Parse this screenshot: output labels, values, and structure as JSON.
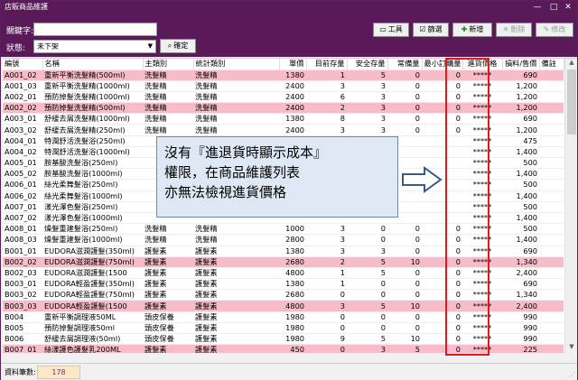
{
  "window": {
    "title": "店販商品維護",
    "min": "—",
    "max": "□",
    "close": "✕"
  },
  "filters": {
    "keyword_label": "關鍵字:",
    "keyword_value": "",
    "status_label": "狀態:",
    "status_value": "未下架",
    "confirm_label": "確定"
  },
  "toolbar": {
    "tools_label": "工具",
    "filter_label": "篩選",
    "add_label": "新增",
    "delete_label": "刪除",
    "edit_label": "修改"
  },
  "columns": [
    "編號",
    "名稱",
    "主類別",
    "統計類別",
    "單價",
    "目前存量",
    "安全存量",
    "常備量",
    "最小訂購量",
    "進貨價格",
    "損料/售價",
    "備註"
  ],
  "rows": [
    {
      "id": "A001_02",
      "name": "重新平衡洗髮精(500ml)",
      "cat": "洗髮精",
      "stat": "洗髮精",
      "price": "1380",
      "stock": "1",
      "safe": "5",
      "regular": "0",
      "min": "0",
      "cost": "*****",
      "ratio": "690",
      "note": "",
      "pink": true
    },
    {
      "id": "A001_03",
      "name": "重新平衡洗髮精(1000ml)",
      "cat": "洗髮精",
      "stat": "洗髮精",
      "price": "2400",
      "stock": "3",
      "safe": "3",
      "regular": "0",
      "min": "0",
      "cost": "*****",
      "ratio": "1,200",
      "note": "",
      "pink": false
    },
    {
      "id": "A002_01",
      "name": "預防掉髮洗髮精(1000ml)",
      "cat": "洗髮精",
      "stat": "洗髮精",
      "price": "2400",
      "stock": "6",
      "safe": "3",
      "regular": "0",
      "min": "0",
      "cost": "*****",
      "ratio": "1,200",
      "note": "",
      "pink": false
    },
    {
      "id": "A002_02",
      "name": "預防掉髮洗髮精(500ml)",
      "cat": "洗髮精",
      "stat": "洗髮精",
      "price": "2400",
      "stock": "2",
      "safe": "3",
      "regular": "0",
      "min": "0",
      "cost": "*****",
      "ratio": "1,200",
      "note": "",
      "pink": true
    },
    {
      "id": "A003_01",
      "name": "舒緩去屑洗髮精(1000ml)",
      "cat": "洗髮精",
      "stat": "洗髮精",
      "price": "1380",
      "stock": "8",
      "safe": "3",
      "regular": "0",
      "min": "0",
      "cost": "*****",
      "ratio": "690",
      "note": "",
      "pink": false
    },
    {
      "id": "A003_02",
      "name": "舒緩去屑洗髮精(250ml)",
      "cat": "洗髮精",
      "stat": "洗髮精",
      "price": "2400",
      "stock": "3",
      "safe": "3",
      "regular": "0",
      "min": "0",
      "cost": "*****",
      "ratio": "1,200",
      "note": "",
      "pink": false
    },
    {
      "id": "A004_01",
      "name": "特潤舒活洗髮浴(250ml)",
      "cat": "",
      "stat": "",
      "price": "",
      "stock": "",
      "safe": "",
      "regular": "",
      "min": "",
      "cost": "*****",
      "ratio": "475",
      "note": "",
      "pink": false
    },
    {
      "id": "A004_02",
      "name": "特潤舒活洗髮浴(1000ml)",
      "cat": "",
      "stat": "",
      "price": "",
      "stock": "",
      "safe": "",
      "regular": "",
      "min": "",
      "cost": "*****",
      "ratio": "1,400",
      "note": "",
      "pink": false
    },
    {
      "id": "A005_01",
      "name": "胺基酸洗髮浴(250ml)",
      "cat": "",
      "stat": "",
      "price": "",
      "stock": "",
      "safe": "",
      "regular": "",
      "min": "",
      "cost": "*****",
      "ratio": "500",
      "note": "",
      "pink": false
    },
    {
      "id": "A005_02",
      "name": "胺基酸洗髮浴(1000ml)",
      "cat": "",
      "stat": "",
      "price": "",
      "stock": "",
      "safe": "",
      "regular": "",
      "min": "",
      "cost": "*****",
      "ratio": "1,400",
      "note": "",
      "pink": false
    },
    {
      "id": "A006_01",
      "name": "絲光柔舞髮浴(250ml)",
      "cat": "",
      "stat": "",
      "price": "",
      "stock": "",
      "safe": "",
      "regular": "",
      "min": "",
      "cost": "*****",
      "ratio": "500",
      "note": "",
      "pink": false
    },
    {
      "id": "A006_02",
      "name": "絲光柔舞髮浴(1000ml)",
      "cat": "",
      "stat": "",
      "price": "",
      "stock": "",
      "safe": "",
      "regular": "",
      "min": "",
      "cost": "*****",
      "ratio": "1,400",
      "note": "",
      "pink": false
    },
    {
      "id": "A007_01",
      "name": "漾光澤色髮浴(250ml)",
      "cat": "",
      "stat": "",
      "price": "",
      "stock": "",
      "safe": "",
      "regular": "",
      "min": "",
      "cost": "*****",
      "ratio": "500",
      "note": "",
      "pink": false
    },
    {
      "id": "A007_02",
      "name": "漾光澤色髮浴(1000ml)",
      "cat": "",
      "stat": "",
      "price": "",
      "stock": "",
      "safe": "",
      "regular": "",
      "min": "",
      "cost": "*****",
      "ratio": "1,400",
      "note": "",
      "pink": false
    },
    {
      "id": "A008_01",
      "name": "燥髮重建髮浴(250ml)",
      "cat": "洗髮精",
      "stat": "洗髮精",
      "price": "1000",
      "stock": "3",
      "safe": "0",
      "regular": "0",
      "min": "0",
      "cost": "*****",
      "ratio": "500",
      "note": "",
      "pink": false
    },
    {
      "id": "A008_03",
      "name": "燥髮重建髮浴(1000ml)",
      "cat": "洗髮精",
      "stat": "洗髮精",
      "price": "2800",
      "stock": "3",
      "safe": "0",
      "regular": "0",
      "min": "0",
      "cost": "*****",
      "ratio": "1,400",
      "note": "",
      "pink": false
    },
    {
      "id": "B001_01",
      "name": "EUDORA滋潤護髮(350ml)",
      "cat": "護髮素",
      "stat": "護髮素",
      "price": "1380",
      "stock": "3",
      "safe": "3",
      "regular": "0",
      "min": "0",
      "cost": "*****",
      "ratio": "690",
      "note": "",
      "pink": false
    },
    {
      "id": "B002_02",
      "name": "EUDORA滋潤護髮(750ml)",
      "cat": "護髮素",
      "stat": "護髮素",
      "price": "2680",
      "stock": "2",
      "safe": "5",
      "regular": "10",
      "min": "0",
      "cost": "*****",
      "ratio": "1,340",
      "note": "",
      "pink": true
    },
    {
      "id": "B002_03",
      "name": "EUDORA滋潤護髮(1500",
      "cat": "護髮素",
      "stat": "護髮素",
      "price": "4800",
      "stock": "1",
      "safe": "5",
      "regular": "0",
      "min": "0",
      "cost": "*****",
      "ratio": "2,400",
      "note": "",
      "pink": false
    },
    {
      "id": "B003_01",
      "name": "EUDORA輕盈護髮(350ml)",
      "cat": "護髮素",
      "stat": "護髮素",
      "price": "1380",
      "stock": "1",
      "safe": "0",
      "regular": "0",
      "min": "0",
      "cost": "*****",
      "ratio": "690",
      "note": "",
      "pink": false
    },
    {
      "id": "B003_02",
      "name": "EUDORA輕盈護髮(750ml)",
      "cat": "護髮素",
      "stat": "護髮素",
      "price": "2680",
      "stock": "0",
      "safe": "0",
      "regular": "0",
      "min": "0",
      "cost": "*****",
      "ratio": "1,340",
      "note": "",
      "pink": false
    },
    {
      "id": "B003_03",
      "name": "EUDORA輕盈護髮(1500",
      "cat": "護髮素",
      "stat": "護髮素",
      "price": "4800",
      "stock": "3",
      "safe": "5",
      "regular": "10",
      "min": "0",
      "cost": "*****",
      "ratio": "2,400",
      "note": "",
      "pink": true
    },
    {
      "id": "B004",
      "name": "重新平衡調理液50ML",
      "cat": "頭皮保養",
      "stat": "護髮素",
      "price": "1980",
      "stock": "0",
      "safe": "0",
      "regular": "0",
      "min": "0",
      "cost": "*****",
      "ratio": "990",
      "note": "",
      "pink": false
    },
    {
      "id": "B005",
      "name": "預防掉髮調理液50ml",
      "cat": "頭皮保養",
      "stat": "護髮素",
      "price": "1980",
      "stock": "0",
      "safe": "0",
      "regular": "0",
      "min": "0",
      "cost": "*****",
      "ratio": "990",
      "note": "",
      "pink": false
    },
    {
      "id": "B006",
      "name": "舒緩去屑調理液(50ml)",
      "cat": "頭皮保養",
      "stat": "護髮素",
      "price": "1980",
      "stock": "9",
      "safe": "5",
      "regular": "10",
      "min": "0",
      "cost": "*****",
      "ratio": "990",
      "note": "",
      "pink": false
    },
    {
      "id": "B007_01",
      "name": "絲漾護色護髮乳200ML",
      "cat": "護髮素",
      "stat": "護髮素",
      "price": "450",
      "stock": "0",
      "safe": "3",
      "regular": "5",
      "min": "0",
      "cost": "*****",
      "ratio": "225",
      "note": "",
      "pink": true
    }
  ],
  "callout": {
    "line1": "沒有『進退貨時顯示成本』",
    "line2": "權限，在商品維護列表",
    "line3": "亦無法檢視進貨價格"
  },
  "status": {
    "count_label": "資料筆數:",
    "count_value": "178"
  },
  "colors": {
    "title_bar": "#5a1a5a",
    "highlight_row": "#f7bcc8",
    "red_box": "#e01a1a",
    "callout_bg": "#dde8f4"
  }
}
